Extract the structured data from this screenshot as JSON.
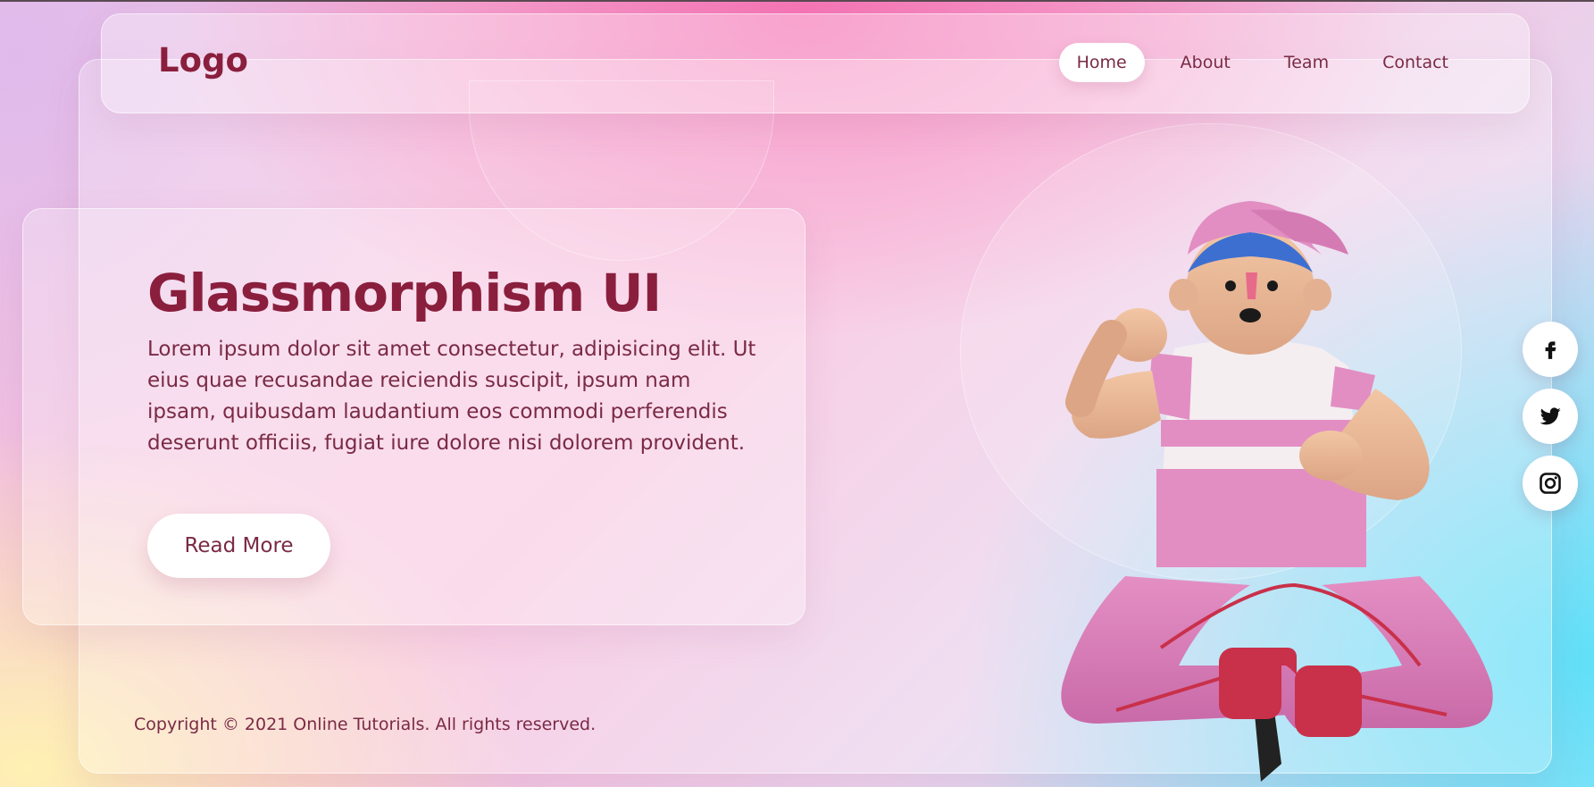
{
  "nav": {
    "logo": "Logo",
    "items": [
      {
        "label": "Home",
        "active": true
      },
      {
        "label": "About",
        "active": false
      },
      {
        "label": "Team",
        "active": false
      },
      {
        "label": "Contact",
        "active": false
      }
    ]
  },
  "hero": {
    "title": "Glassmorphism UI",
    "text": "Lorem ipsum dolor sit amet consectetur, adipisicing elit. Ut eius quae recusandae reiciendis suscipit, ipsum nam ipsam, quibusdam laudantium eos commodi perferendis deserunt officiis, fugiat iure dolore nisi dolorem provident.",
    "button_label": "Read More"
  },
  "footer": {
    "copyright": "Copyright © 2021 Online Tutorials. All rights reserved."
  },
  "social": [
    {
      "icon": "facebook-icon"
    },
    {
      "icon": "twitter-icon"
    },
    {
      "icon": "instagram-icon"
    }
  ],
  "colors": {
    "title": "#8a1f3d",
    "body_text": "#7a2a44",
    "pink": "#f570b2",
    "cyan": "#5fe0f8",
    "yellow": "#fff4b0"
  }
}
